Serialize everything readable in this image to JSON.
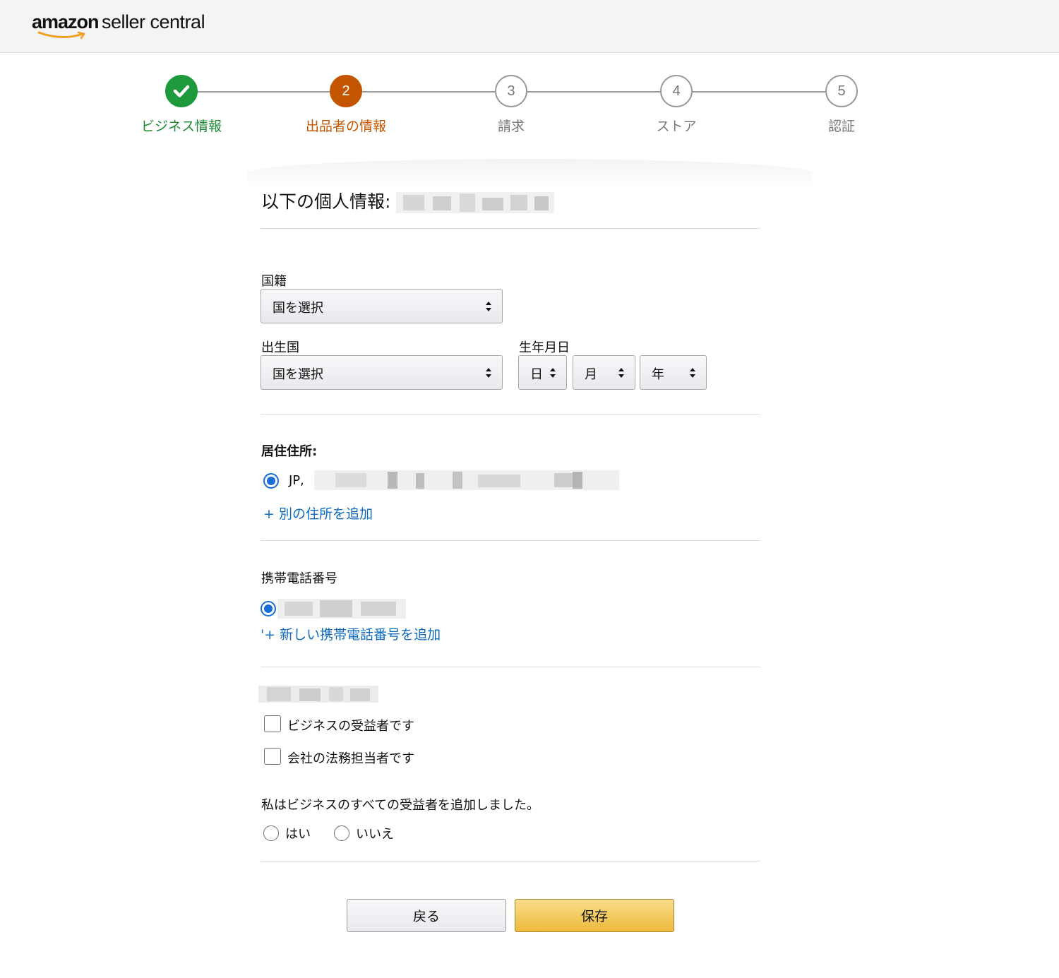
{
  "header": {
    "logo_amazon": "amazon",
    "logo_rest": "seller central"
  },
  "stepper": {
    "steps": [
      {
        "number": "",
        "label": "ビジネス情報",
        "state": "done"
      },
      {
        "number": "2",
        "label": "出品者の情報",
        "state": "active"
      },
      {
        "number": "3",
        "label": "請求",
        "state": "todo"
      },
      {
        "number": "4",
        "label": "ストア",
        "state": "todo"
      },
      {
        "number": "5",
        "label": "認証",
        "state": "todo"
      }
    ],
    "colors": {
      "done": "#1e9a3c",
      "active": "#c45500",
      "todo": "#9a9a9a"
    }
  },
  "form": {
    "title": "以下の個人情報:",
    "nationality": {
      "label": "国籍",
      "value": "国を選択"
    },
    "birth_country": {
      "label": "出生国",
      "value": "国を選択"
    },
    "birthdate": {
      "label": "生年月日",
      "day": "日",
      "month": "月",
      "year": "年"
    },
    "address": {
      "label": "居住住所:",
      "value_prefix": "JP,",
      "add_link": "+ 別の住所を追加"
    },
    "phone": {
      "label": "携帯電話番号",
      "add_link": "'+ 新しい携帯電話番号を追加"
    },
    "roles": {
      "options": [
        "ビジネスの受益者です",
        "会社の法務担当者です"
      ]
    },
    "beneficiaries": {
      "question": "私はビジネスのすべての受益者を追加しました。",
      "yes": "はい",
      "no": "いいえ"
    }
  },
  "buttons": {
    "back": "戻る",
    "save": "保存"
  }
}
